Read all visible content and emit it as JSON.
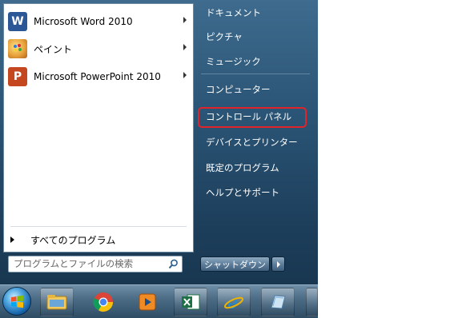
{
  "left_panel": {
    "programs": [
      {
        "label": "Microsoft Word 2010",
        "icon": "word-icon",
        "color": "#2b5797"
      },
      {
        "label": "ペイント",
        "icon": "paint-icon",
        "color": "#e8a23a"
      },
      {
        "label": "Microsoft PowerPoint 2010",
        "icon": "powerpoint-icon",
        "color": "#c5471f"
      }
    ],
    "all_programs_label": "すべてのプログラム"
  },
  "search": {
    "placeholder": "プログラムとファイルの検索",
    "value": ""
  },
  "right_panel": {
    "items": [
      {
        "label": "ドキュメント"
      },
      {
        "label": "ピクチャ"
      },
      {
        "label": "ミュージック"
      },
      {
        "label": "コンピューター"
      },
      {
        "label": "コントロール パネル"
      },
      {
        "label": "デバイスとプリンター"
      },
      {
        "label": "既定のプログラム"
      },
      {
        "label": "ヘルプとサポート"
      }
    ],
    "highlight_color": "#e0242a"
  },
  "shutdown": {
    "label": "シャットダウン"
  },
  "taskbar": {
    "items": [
      "windows-explorer-icon",
      "chrome-icon",
      "media-player-icon",
      "excel-icon",
      "internet-explorer-icon",
      "app-icon"
    ]
  }
}
